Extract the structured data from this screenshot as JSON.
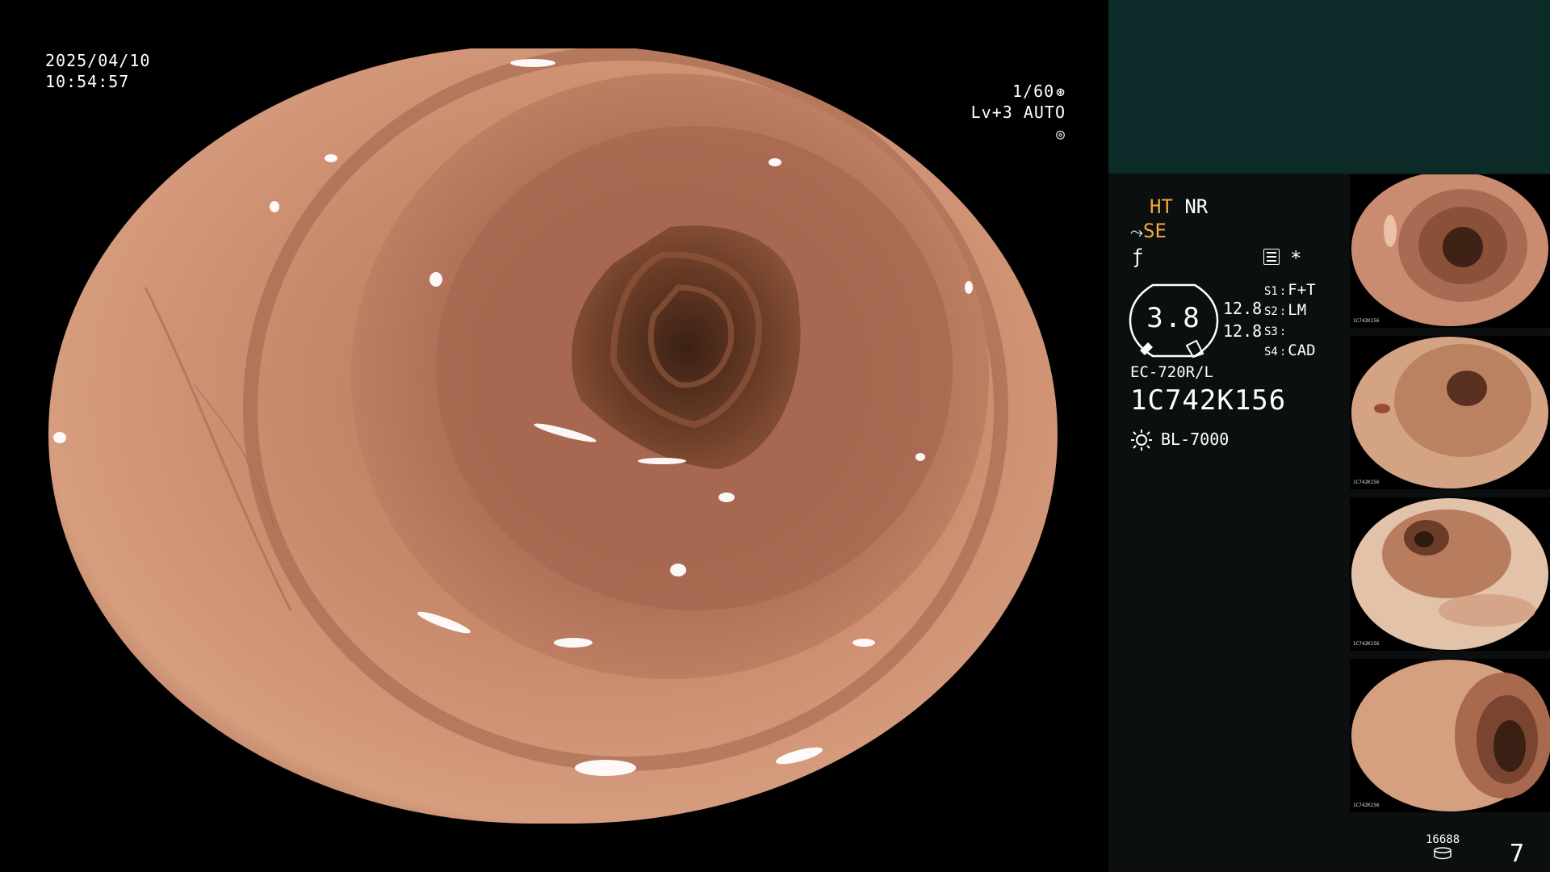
{
  "overlay": {
    "date": "2025/04/10",
    "time": "10:54:57",
    "shutter": "1/60",
    "level": "Lv+3 AUTO"
  },
  "panel": {
    "mode_ht": "HT",
    "mode_nr": "NR",
    "mode_se": "SE",
    "asterisk": "*",
    "badge_value": "3.8",
    "value_a": "12.8",
    "value_b": "12.8",
    "slots": [
      {
        "key": "S1",
        "value": "F+T"
      },
      {
        "key": "S2",
        "value": "LM"
      },
      {
        "key": "S3",
        "value": ""
      },
      {
        "key": "S4",
        "value": "CAD"
      }
    ],
    "scope_model": "EC-720R/L",
    "scope_serial": "1C742K156",
    "lamp_model": "BL-7000"
  },
  "status": {
    "storage_count": "16688",
    "image_count": "7"
  },
  "colors": {
    "panel_top": "#0c2a28",
    "panel_bottom": "#0b0f0f",
    "highlight": "#f2a93a"
  },
  "thumbnails": [
    {
      "caption": "1C742K156"
    },
    {
      "caption": "1C742K156"
    },
    {
      "caption": "1C742K156"
    },
    {
      "caption": "1C742K156"
    }
  ],
  "icons": [
    "shutter-icon",
    "auto-iris-icon",
    "enhance-icon",
    "filter-icon",
    "settings-icon",
    "lamp-icon",
    "storage-icon"
  ]
}
